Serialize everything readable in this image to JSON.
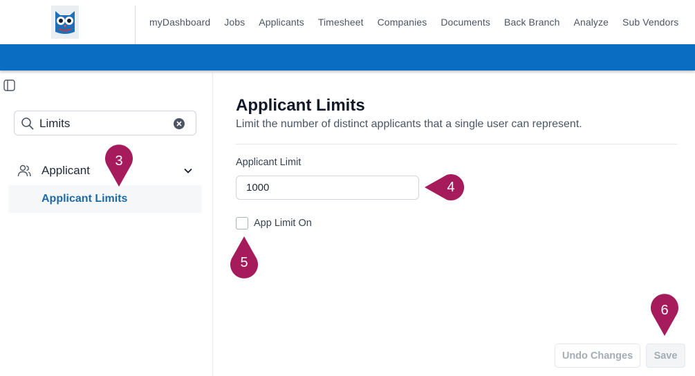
{
  "nav": {
    "items": [
      "myDashboard",
      "Jobs",
      "Applicants",
      "Timesheet",
      "Companies",
      "Documents",
      "Back Branch",
      "Analyze",
      "Sub Vendors"
    ]
  },
  "sidebar": {
    "search_value": "Limits",
    "group_label": "Applicant",
    "sub_item_label": "Applicant Limits"
  },
  "main": {
    "title": "Applicant Limits",
    "description": "Limit the number of distinct applicants that a single user can represent.",
    "limit_label": "Applicant Limit",
    "limit_value": "1000",
    "checkbox_label": "App Limit On",
    "undo_label": "Undo Changes",
    "save_label": "Save"
  },
  "markers": {
    "m3": "3",
    "m4": "4",
    "m5": "5",
    "m6": "6"
  },
  "colors": {
    "accent_blue": "#0a6dc2",
    "marker": "#a61b5c",
    "link": "#1e6aa8"
  }
}
